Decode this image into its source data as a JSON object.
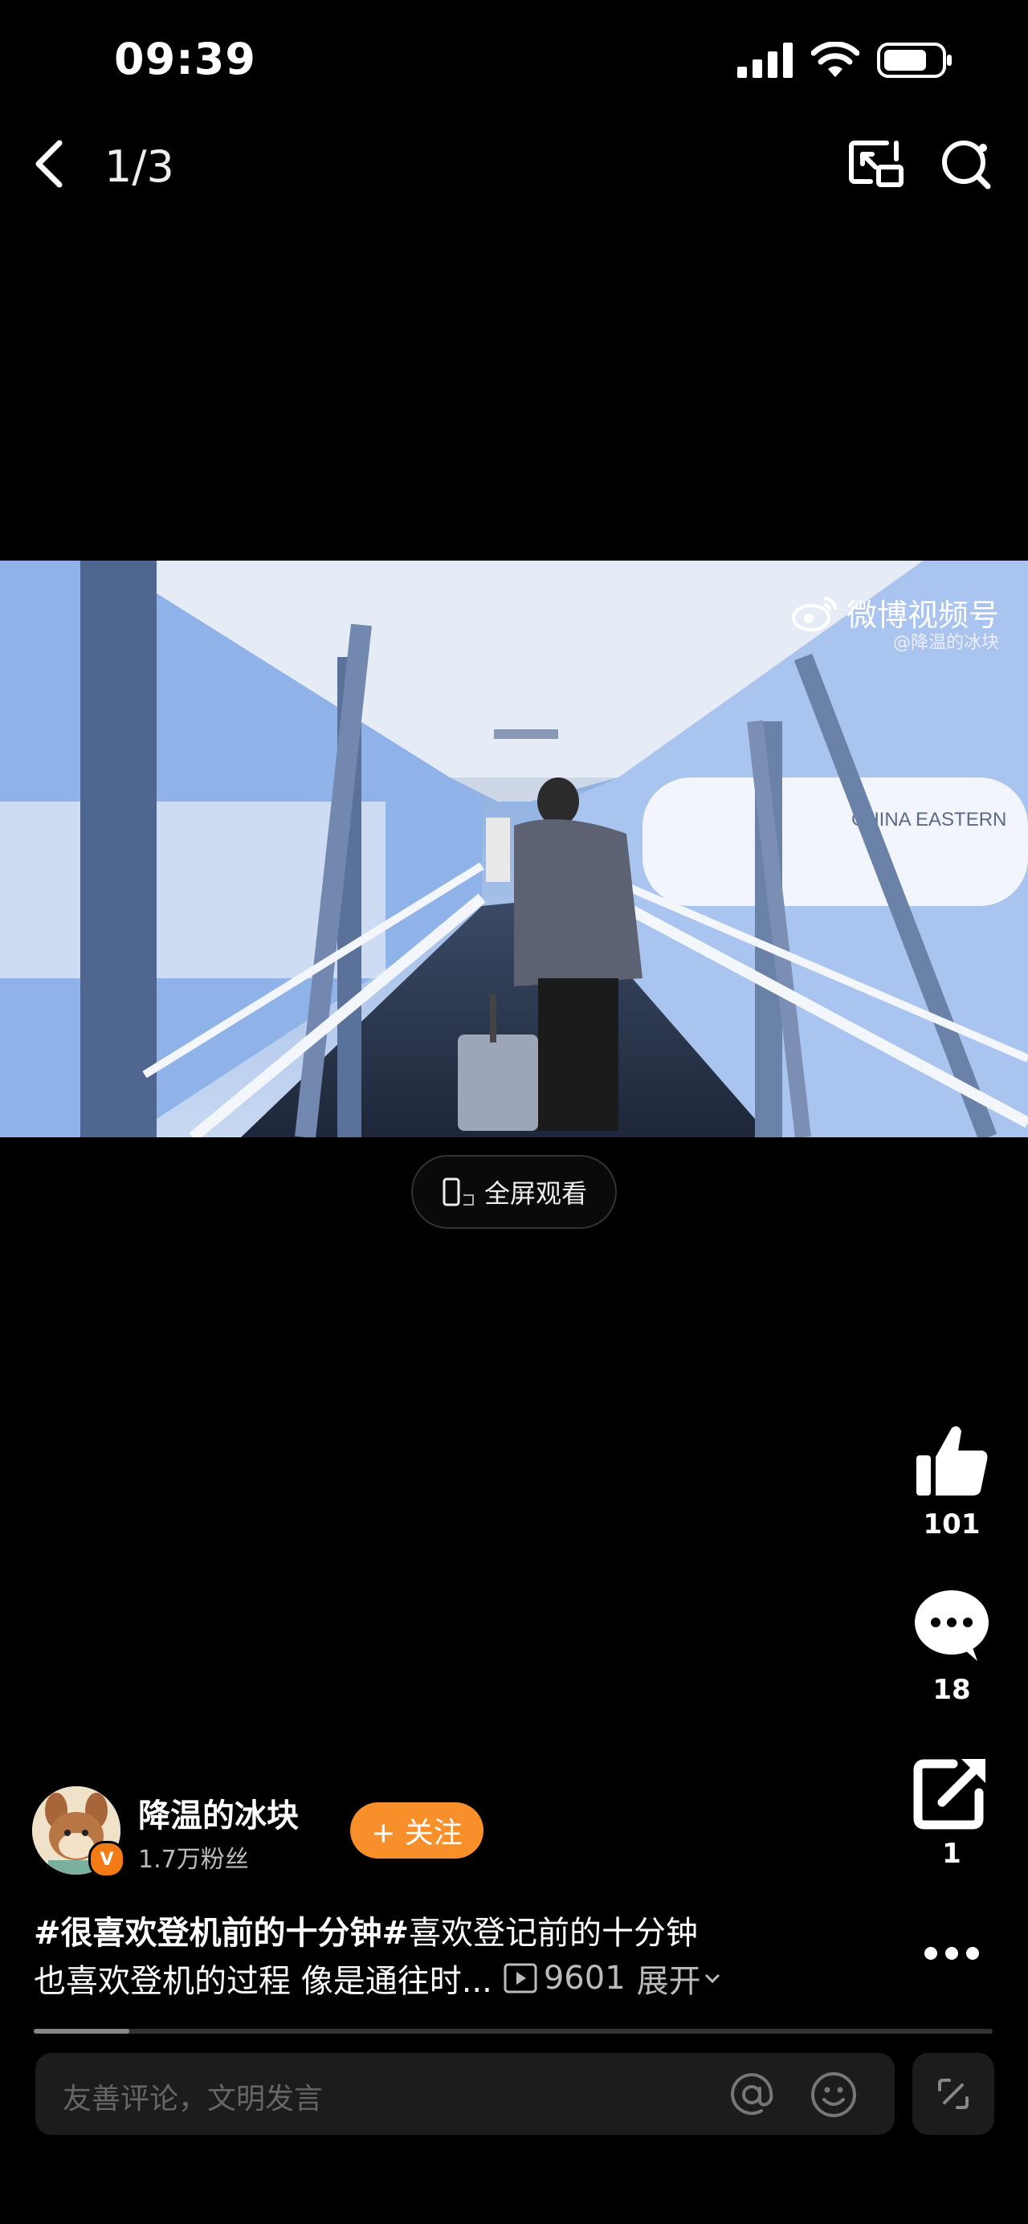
{
  "status_bar": {
    "time": "09:39"
  },
  "nav": {
    "page_counter": "1/3"
  },
  "video": {
    "watermark": "微博视频号",
    "watermark_sub": "@降温的冰块",
    "plane_text": "CHINA EASTERN"
  },
  "fullscreen": {
    "label": "全屏观看"
  },
  "actions": {
    "like_count": "101",
    "comment_count": "18",
    "share_count": "1"
  },
  "author": {
    "name": "降温的冰块",
    "fans": "1.7万粉丝",
    "follow_label": "+ 关注",
    "verified_mark": "V"
  },
  "caption": {
    "hashtag": "#很喜欢登机前的十分钟#",
    "line1_text": "喜欢登记前的十分钟",
    "line2_text": "也喜欢登机的过程 像是通往时...",
    "views": "9601",
    "expand_label": "展开"
  },
  "progress": {
    "value": 0.1
  },
  "comment": {
    "placeholder": "友善评论，文明发言"
  },
  "colors": {
    "accent": "#f7902a",
    "background": "#000000",
    "verified": "#f47a16"
  }
}
